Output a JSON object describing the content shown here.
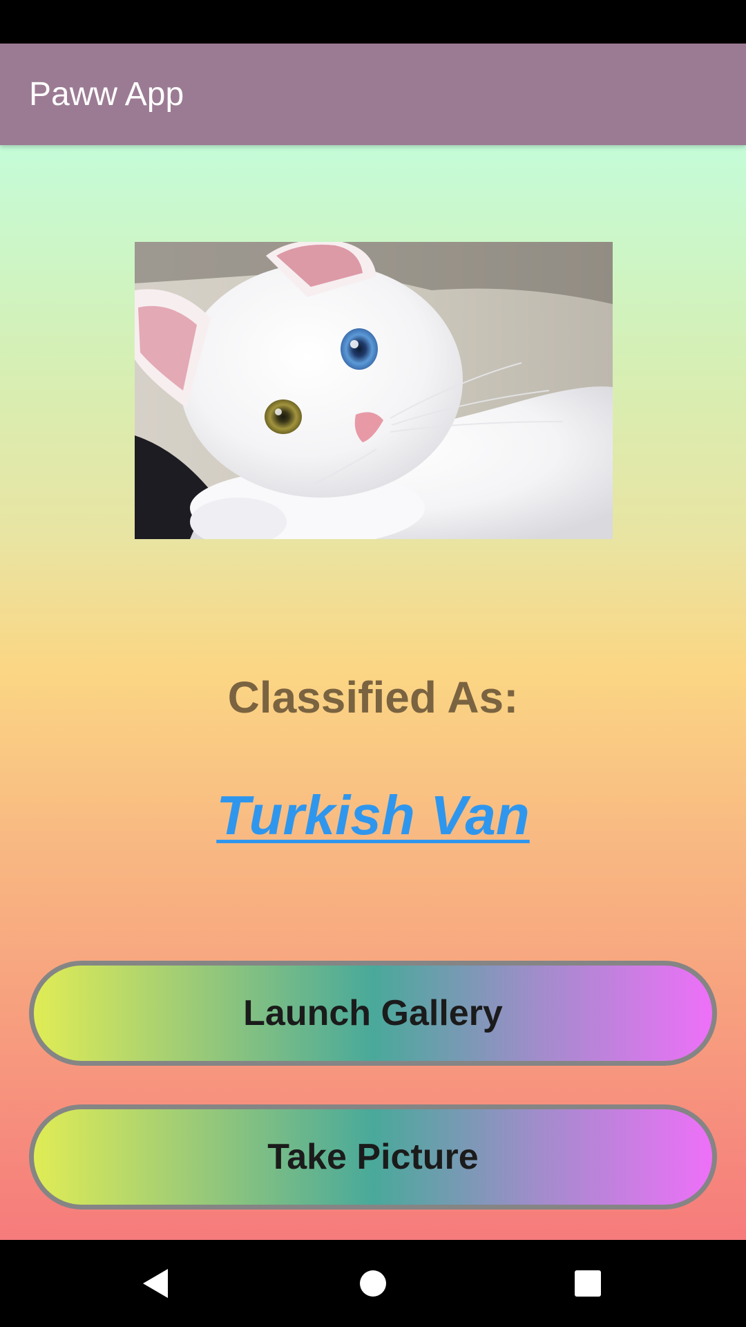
{
  "app_bar": {
    "title": "Paww App"
  },
  "photo": {
    "subject": "white kitten with heterochromatic eyes (blue and amber)"
  },
  "classification": {
    "label": "Classified As:",
    "result": "Turkish Van"
  },
  "buttons": {
    "launch_gallery": "Launch Gallery",
    "take_picture": "Take Picture"
  },
  "nav": {
    "back_icon": "back-triangle-icon",
    "home_icon": "home-circle-icon",
    "recents_icon": "recents-square-icon"
  },
  "colors": {
    "app_bar": "#9b7b93",
    "classified_text": "#7a6340",
    "result_link": "#2f96ee",
    "button_border": "#858585",
    "button_text": "#1b1b1b"
  }
}
